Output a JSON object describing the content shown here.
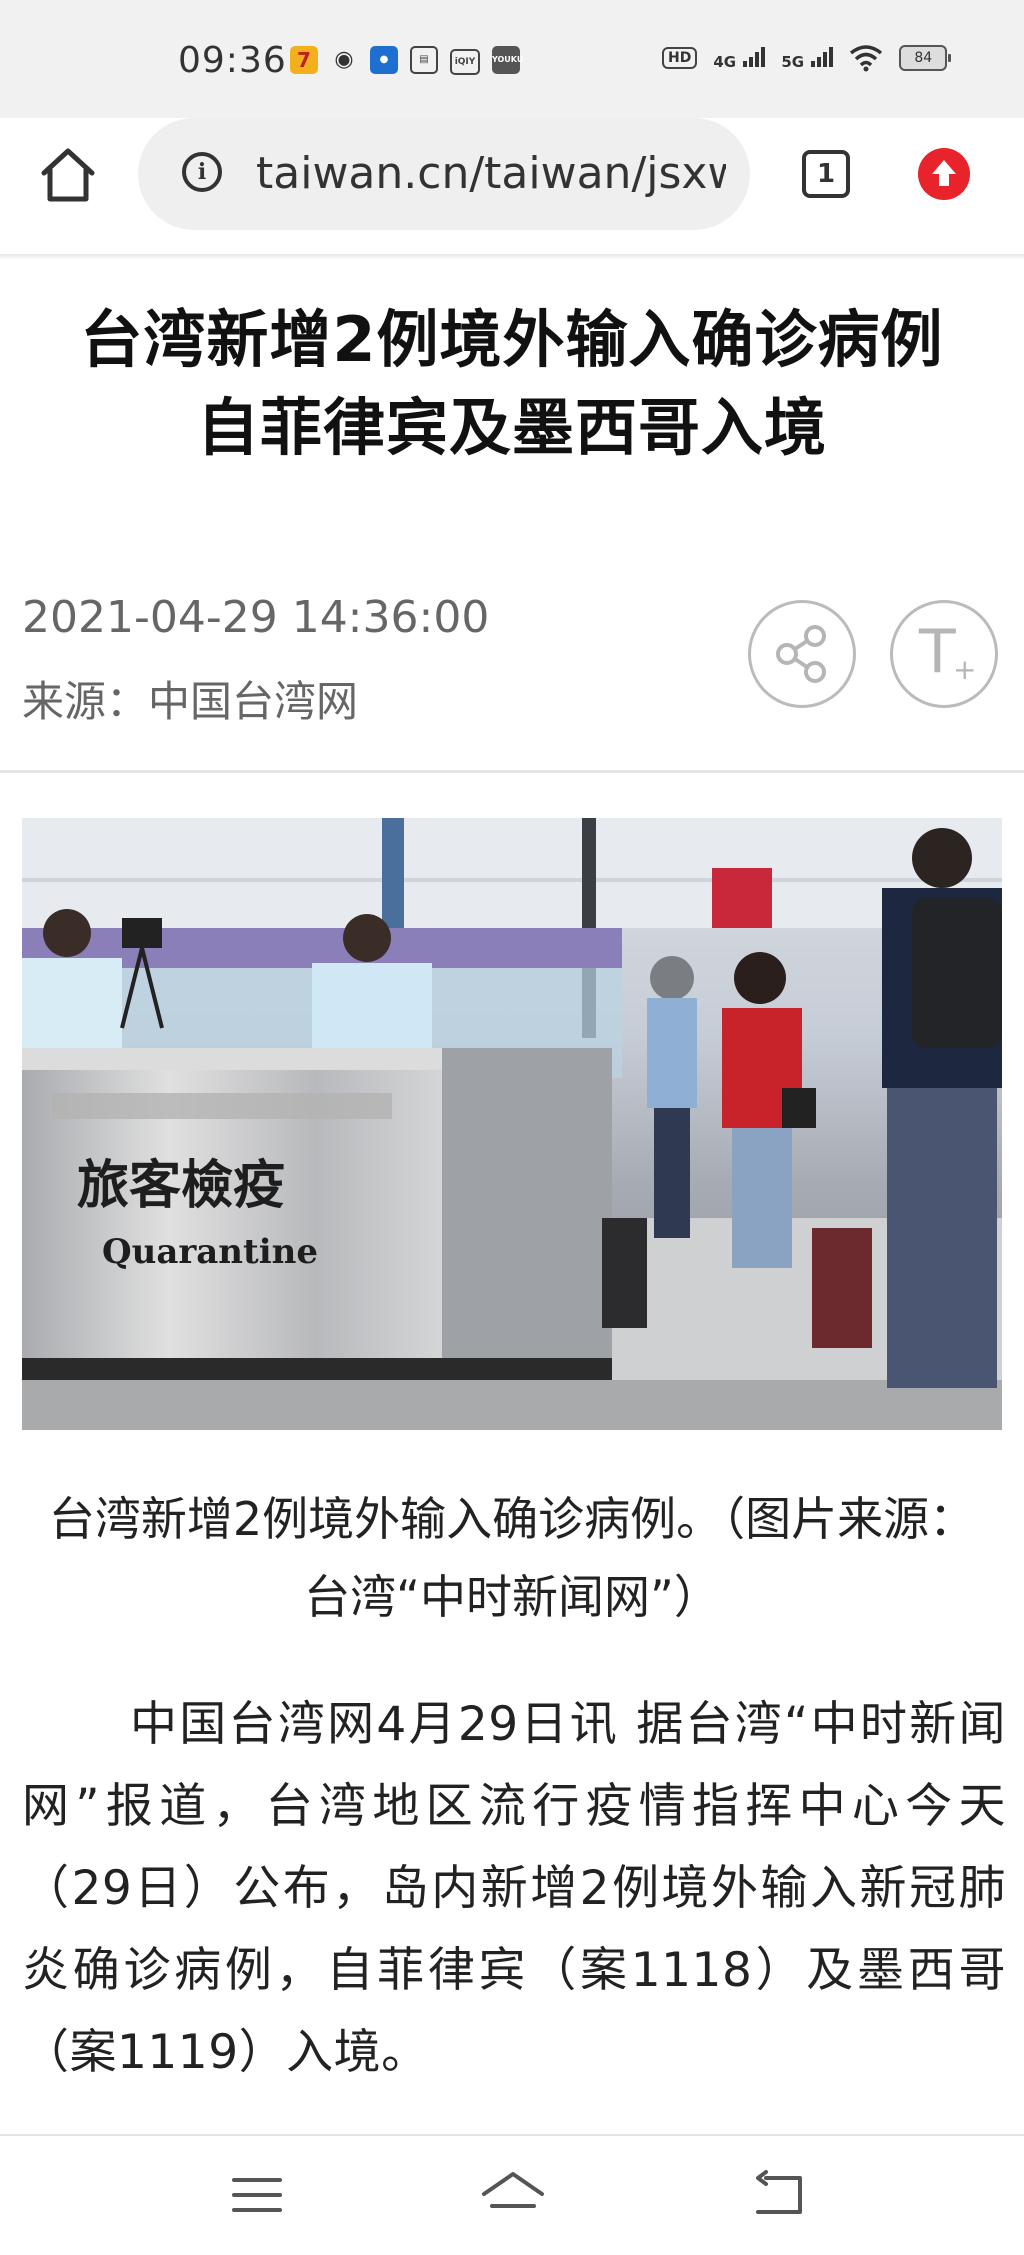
{
  "status_bar": {
    "time": "09:36",
    "notification_icons": [
      "seven-icon",
      "weibo-icon",
      "app-icon",
      "reader-icon",
      "iqiyi-icon",
      "youku-icon"
    ],
    "hd_label": "HD",
    "network_4g": "4G",
    "network_5g": "5G",
    "battery": "84"
  },
  "browser": {
    "url": "taiwan.cn/taiwan/jsxw",
    "tab_count": "1"
  },
  "article": {
    "title_line1": "台湾新增2例境外输入确诊病例",
    "title_line2": "自菲律宾及墨西哥入境",
    "datetime": "2021-04-29 14:36:00",
    "source": "来源：中国台湾网",
    "photo_sign_zh": "旅客檢疫",
    "photo_sign_en": "Quarantine",
    "caption": "台湾新增2例境外输入确诊病例。（图片来源：台湾“中时新闻网”）",
    "body": "中国台湾网4月29日讯 据台湾“中时新闻网”报道，台湾地区流行疫情指挥中心今天（29日）公布，岛内新增2例境外输入新冠肺炎确诊病例，自菲律宾（案1118）及墨西哥（案1119）入境。"
  },
  "colors": {
    "accent_red": "#e8232b",
    "status_bg": "#f1f1f1"
  }
}
